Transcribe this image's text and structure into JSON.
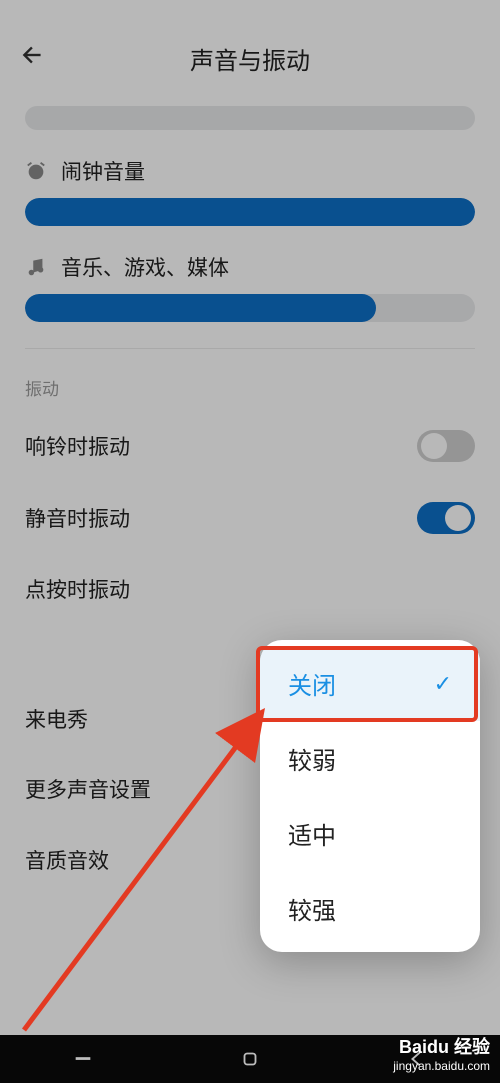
{
  "header": {
    "title": "声音与振动"
  },
  "sliders": {
    "alarm": {
      "label": "闹钟音量",
      "fill_pct": 100
    },
    "media": {
      "label": "音乐、游戏、媒体",
      "fill_pct": 78
    }
  },
  "vibration": {
    "group_title": "振动",
    "ring": {
      "label": "响铃时振动",
      "on": false
    },
    "silent": {
      "label": "静音时振动",
      "on": true
    },
    "touch": {
      "label": "点按时振动"
    }
  },
  "popup": {
    "options": [
      {
        "label": "关闭",
        "selected": true
      },
      {
        "label": "较弱",
        "selected": false
      },
      {
        "label": "适中",
        "selected": false
      },
      {
        "label": "较强",
        "selected": false
      }
    ]
  },
  "more_rows": {
    "caller_show": {
      "label": "来电秀"
    },
    "more_sound": {
      "label": "更多声音设置"
    },
    "sound_effect": {
      "label": "音质音效"
    }
  },
  "watermark": {
    "brand": "Baidu 经验",
    "url": "jingyan.baidu.com"
  },
  "colors": {
    "accent": "#0d6fc7",
    "popup_accent": "#1a8fe3",
    "highlight": "#e33a22"
  }
}
